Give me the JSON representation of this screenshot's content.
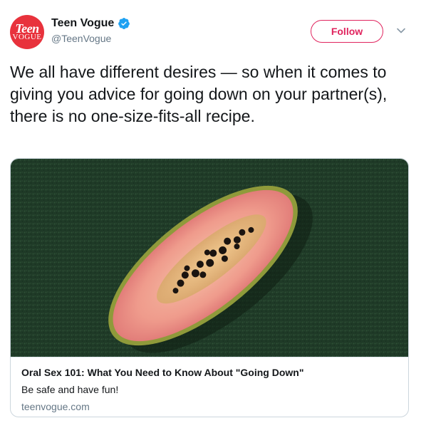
{
  "account": {
    "avatar_logo_top": "Teen",
    "avatar_logo_bottom": "VOGUE",
    "display_name": "Teen Vogue",
    "handle": "@TeenVogue",
    "verified": true,
    "verified_icon": "verified-badge-icon",
    "avatar_color": "#e8323c"
  },
  "actions": {
    "follow_label": "Follow",
    "menu_icon": "chevron-down-icon",
    "accent_color": "#e0245e"
  },
  "tweet": {
    "text": "We all have different desires — so when it comes to giving you advice for going down on your partner(s), there is no one-size-fits-all recipe."
  },
  "card": {
    "image_subject": "halved papaya on green textured background",
    "title": "Oral Sex 101: What You Need to Know About \"Going Down\"",
    "description": "Be safe and have fun!",
    "domain": "teenvogue.com"
  }
}
